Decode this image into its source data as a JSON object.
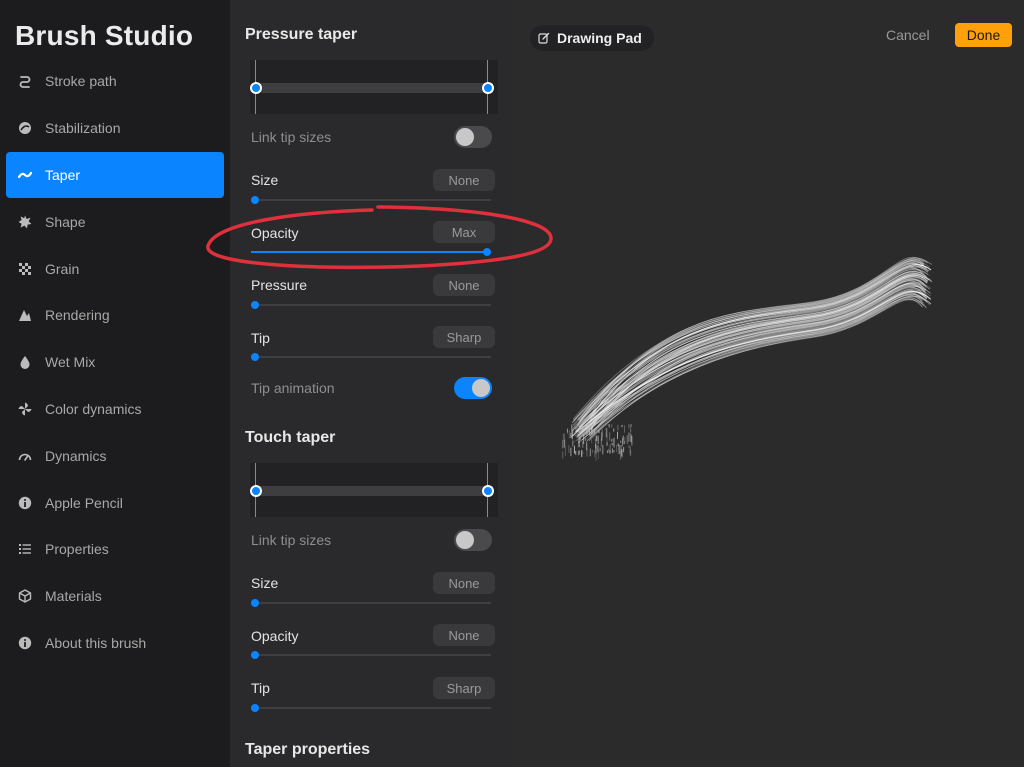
{
  "app_title": "Brush Studio",
  "sidebar": {
    "items": [
      {
        "label": "Stroke path",
        "icon": "stroke-path-icon"
      },
      {
        "label": "Stabilization",
        "icon": "stabilization-icon"
      },
      {
        "label": "Taper",
        "icon": "taper-icon",
        "active": true
      },
      {
        "label": "Shape",
        "icon": "shape-icon"
      },
      {
        "label": "Grain",
        "icon": "grain-icon"
      },
      {
        "label": "Rendering",
        "icon": "rendering-icon"
      },
      {
        "label": "Wet Mix",
        "icon": "wet-mix-icon"
      },
      {
        "label": "Color dynamics",
        "icon": "color-dynamics-icon"
      },
      {
        "label": "Dynamics",
        "icon": "dynamics-icon"
      },
      {
        "label": "Apple Pencil",
        "icon": "apple-pencil-icon"
      },
      {
        "label": "Properties",
        "icon": "properties-icon"
      },
      {
        "label": "Materials",
        "icon": "materials-icon"
      },
      {
        "label": "About this brush",
        "icon": "info-icon"
      }
    ]
  },
  "panel": {
    "pressure_taper": {
      "title": "Pressure taper",
      "link_tip_sizes": {
        "label": "Link tip sizes",
        "on": false
      },
      "size": {
        "label": "Size",
        "value": "None",
        "level": 0
      },
      "opacity": {
        "label": "Opacity",
        "value": "Max",
        "level": 1
      },
      "pressure": {
        "label": "Pressure",
        "value": "None",
        "level": 0
      },
      "tip": {
        "label": "Tip",
        "value": "Sharp",
        "level": 0
      },
      "tip_animation": {
        "label": "Tip animation",
        "on": true
      }
    },
    "touch_taper": {
      "title": "Touch taper",
      "link_tip_sizes": {
        "label": "Link tip sizes",
        "on": false
      },
      "size": {
        "label": "Size",
        "value": "None",
        "level": 0
      },
      "opacity": {
        "label": "Opacity",
        "value": "None",
        "level": 0
      },
      "tip": {
        "label": "Tip",
        "value": "Sharp",
        "level": 0
      }
    },
    "taper_properties": {
      "title": "Taper properties"
    }
  },
  "drawing_pad": {
    "title": "Drawing Pad",
    "cancel_label": "Cancel",
    "done_label": "Done",
    "accent": "#ff9f0a"
  },
  "colors": {
    "accent": "#0a84ff",
    "annotation": "#e0303c"
  }
}
